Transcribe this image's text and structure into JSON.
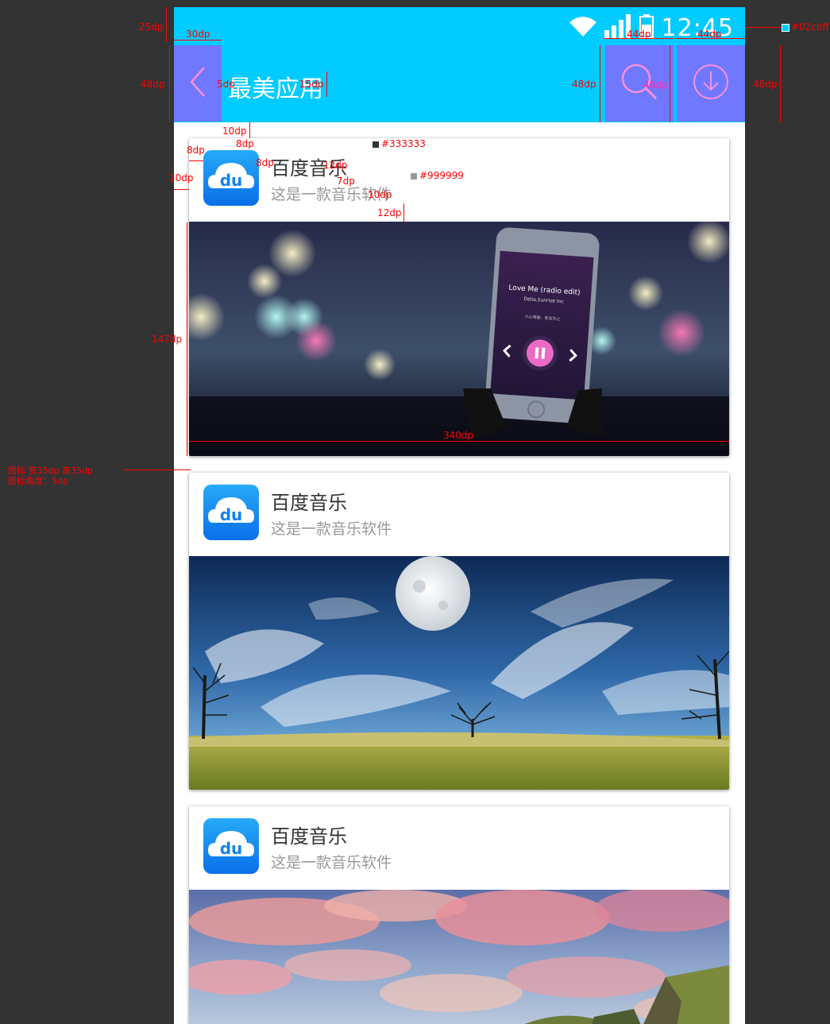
{
  "status_bar": {
    "time": "12:45"
  },
  "app_bar": {
    "title": "最美应用"
  },
  "colors": {
    "app_bar_bg": "#02cbff",
    "primary_text": "#333333",
    "secondary_text": "#999999"
  },
  "cards": [
    {
      "app_name": "百度音乐",
      "description": "这是一款音乐软件",
      "app_icon_text": "du",
      "banner": "night-phone-music-player",
      "player": {
        "song": "Love Me (radio edit)",
        "artist": "Delia,Sunrise Inc",
        "lyric": "小心驾驶，安全为上"
      }
    },
    {
      "app_name": "百度音乐",
      "description": "这是一款音乐软件",
      "app_icon_text": "du",
      "banner": "moon-sky-field"
    },
    {
      "app_name": "百度音乐",
      "description": "这是一款音乐软件",
      "app_icon_text": "du",
      "banner": "sunset-clouds-cliffs"
    }
  ],
  "annotations": {
    "status_height": "25dp",
    "back_width": "30dp",
    "bar_height_left": "48dp",
    "title_gap": "5dp",
    "title_size": "15dp",
    "search_width": "44dp",
    "download_width": "44dp",
    "bar_height_mid": "48dp",
    "icon_size": "48dp",
    "bar_height_right": "48dp",
    "color_tag": "#02cbff",
    "card_top_gap": "10dp",
    "card_padding_top": "8dp",
    "icon_left_pad": "8dp",
    "card_left_gap": "10dp",
    "icon_text_gap": "8dp",
    "title_color": "#333333",
    "title_font": "12dp",
    "line_gap": "7dp",
    "desc_color": "#999999",
    "desc_font": "10dp",
    "desc_bottom": "12dp",
    "banner_height": "147dp",
    "banner_width": "340dp",
    "icon_note_1": "图标 宽35dp 高35dp",
    "icon_note_2": "图标角度：5dp"
  }
}
